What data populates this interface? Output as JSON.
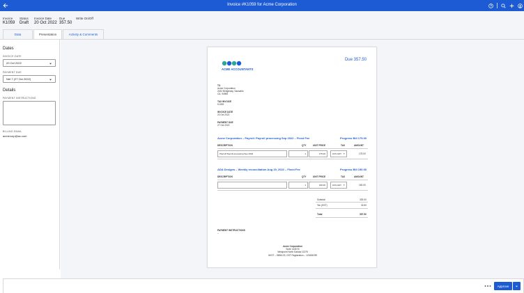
{
  "header": {
    "title": "Invoice #K1059 for Acme Corporation",
    "icons": [
      "back-arrow-icon",
      "help-icon",
      "search-icon",
      "add-icon",
      "user-icon"
    ]
  },
  "summary": {
    "invoice_label": "Invoice",
    "invoice_value": "K1059",
    "status_label": "Status",
    "status_value": "Draft",
    "date_label": "Invoice Date",
    "date_value": "20 Oct 2022",
    "due_label": "Due",
    "due_value": "357.50",
    "write_off": "Write On/Off"
  },
  "tabs": [
    {
      "label": "Data"
    },
    {
      "label": "Presentation"
    },
    {
      "label": "Activity & Comments"
    }
  ],
  "left_panel": {
    "dates_heading": "Dates",
    "invoice_date_label": "INVOICE DATE",
    "invoice_date_value": "20 Oct 2022",
    "payment_due_label": "PAYMENT DUE",
    "payment_due_value": "Net 7 (27 Oct 2022)",
    "details_heading": "Details",
    "payment_instructions_label": "PAYMENT INSTRUCTIONS",
    "billing_email_label": "BILLING EMAIL",
    "billing_email_value": "acmecorp@ac.com"
  },
  "invoice": {
    "due_text": "Due 357.50",
    "to_label": "TO",
    "to_lines": [
      "Acme Corporation",
      "2432 Bridgeway, Sausalito",
      "CA, 94965"
    ],
    "tax_invoice_label": "TAX INVOICE",
    "tax_invoice_value": "K1059",
    "invoice_date_label": "INVOICE DATE",
    "invoice_date_value": "20 Oct 2022",
    "payment_due_label": "PAYMENT DUE",
    "payment_due_value": "27 Oct 2022",
    "lines": [
      {
        "title": "Acme Corporation – Payroll: Payroll processing Sep 2022 – Fixed Fee",
        "progress": "Progress Bill 175.00",
        "description": "Payroll Payroll processing Sep 2022",
        "qty": "1",
        "unit_price": "175.00",
        "tax": "10% GST",
        "amount": "175.00"
      },
      {
        "title": "ADA Designs – Weekly reconciliation Aug 19, 2022 – Fixed Fee",
        "progress": "Progress Bill 150.00",
        "description": "",
        "qty": "1",
        "unit_price": "150.00",
        "tax": "10% GST",
        "amount": "150.00"
      }
    ],
    "columns": {
      "description": "DESCRIPTION",
      "qty": "QTY",
      "unit_price": "UNIT PRICE",
      "tax": "TAX",
      "amount": "AMOUNT"
    },
    "subtotal_label": "Subtotal",
    "subtotal_value": "325.00",
    "tax_label": "Tax (GST)",
    "tax_value": "32.50",
    "total_label": "Total",
    "total_value": "357.50",
    "payment_instructions_label": "PAYMENT INSTRUCTIONS",
    "payment_instructions_value": "–",
    "footer_lines": [
      "Acme Corporation",
      "Suite 1445 St",
      "Westpoint North Dakota 11378",
      "HKST – 5696123, GST Registration – 123456789"
    ]
  },
  "footer": {
    "approve_label": "Approve"
  },
  "colors": {
    "brand": "#1d5bd4",
    "logo_teal": "#2ba79a"
  }
}
